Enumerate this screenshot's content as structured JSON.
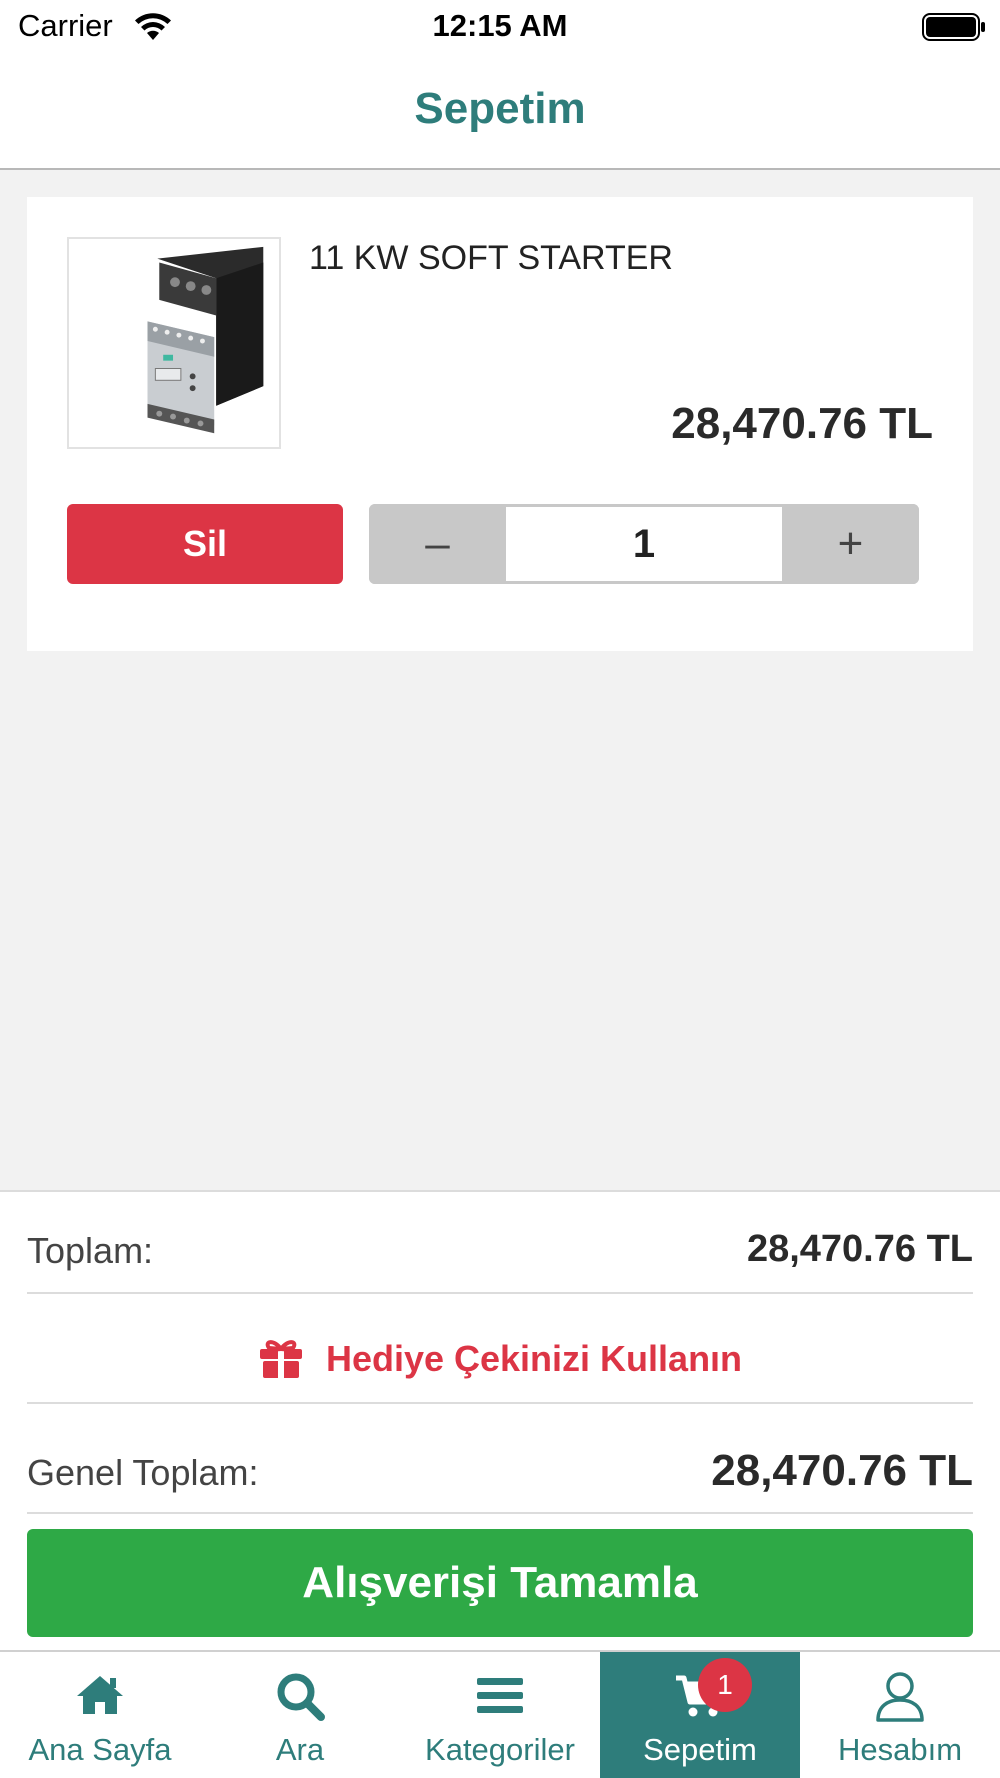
{
  "status_bar": {
    "carrier": "Carrier",
    "time": "12:15 AM"
  },
  "header": {
    "title": "Sepetim"
  },
  "cart": {
    "items": [
      {
        "name": "11 KW SOFT STARTER",
        "price": "28,470.76 TL",
        "quantity": "1",
        "delete_label": "Sil",
        "minus_label": "–",
        "plus_label": "+"
      }
    ]
  },
  "summary": {
    "subtotal_label": "Toplam:",
    "subtotal_value": "28,470.76 TL",
    "gift_label": "Hediye Çekinizi Kullanın",
    "grand_total_label": "Genel Toplam:",
    "grand_total_value": "28,470.76 TL",
    "checkout_label": "Alışverişi Tamamla"
  },
  "tabs": [
    {
      "label": "Ana Sayfa",
      "icon": "home-icon"
    },
    {
      "label": "Ara",
      "icon": "search-icon"
    },
    {
      "label": "Kategoriler",
      "icon": "menu-icon"
    },
    {
      "label": "Sepetim",
      "icon": "cart-icon",
      "badge": "1",
      "active": true
    },
    {
      "label": "Hesabım",
      "icon": "user-icon"
    }
  ],
  "colors": {
    "brand": "#2e7d7b",
    "danger": "#dc3545",
    "success": "#2ea946",
    "background": "#f2f2f2"
  }
}
